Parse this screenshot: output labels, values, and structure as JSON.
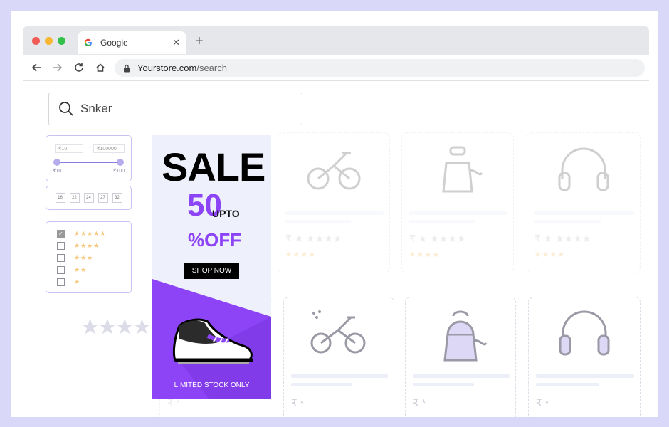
{
  "browser": {
    "tab_title": "Google",
    "url_host": "Yourstore.com",
    "url_path": "/search",
    "dot_colors": [
      "#f05b55",
      "#f7b733",
      "#35c04b"
    ]
  },
  "search": {
    "value": "Snker"
  },
  "filters": {
    "price_min_input": "₹10",
    "price_max_input": "₹100000",
    "range_min_label": "₹10",
    "range_max_label": "₹100",
    "sizes": [
      "16",
      "22",
      "24",
      "27",
      "32"
    ],
    "ratings": [
      {
        "checked": true,
        "stars": 5
      },
      {
        "checked": false,
        "stars": 4
      },
      {
        "checked": false,
        "stars": 3
      },
      {
        "checked": false,
        "stars": 2
      },
      {
        "checked": false,
        "stars": 1
      }
    ]
  },
  "banner": {
    "sale": "SALE",
    "fifty": "50",
    "upto": "UPTO",
    "off": "%OFF",
    "cta": "SHOP NOW",
    "limited": "LIMITED STOCK ONLY",
    "accent": "#8c44f6"
  },
  "products": {
    "currency": "₹",
    "row1": [
      "bicycle-icon",
      "kettle-icon",
      "headphones-icon"
    ],
    "row2": [
      "bicycle-icon",
      "kettle-icon",
      "headphones-icon"
    ]
  }
}
